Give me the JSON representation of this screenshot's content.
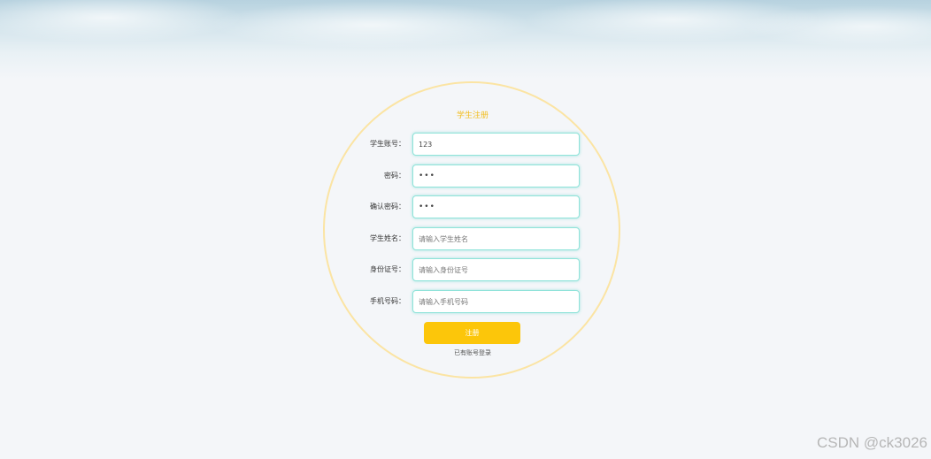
{
  "form": {
    "title": "学生注册",
    "fields": [
      {
        "label": "学生账号：",
        "value": "123",
        "placeholder": "",
        "type": "text"
      },
      {
        "label": "密码：",
        "value": "•••",
        "placeholder": "",
        "type": "password"
      },
      {
        "label": "确认密码：",
        "value": "•••",
        "placeholder": "",
        "type": "password"
      },
      {
        "label": "学生姓名：",
        "value": "",
        "placeholder": "请输入学生姓名",
        "type": "text"
      },
      {
        "label": "身份证号：",
        "value": "",
        "placeholder": "请输入身份证号",
        "type": "text"
      },
      {
        "label": "手机号码：",
        "value": "",
        "placeholder": "请输入手机号码",
        "type": "text"
      }
    ],
    "submit_label": "注册",
    "login_link": "已有账号登录"
  },
  "watermark": "CSDN @ck3026",
  "colors": {
    "accent": "#fcc60a",
    "title": "#f2bc1b",
    "input_border": "#8fe3d9",
    "circle_border": "#fbe4a3",
    "background": "#f4f6f9"
  }
}
